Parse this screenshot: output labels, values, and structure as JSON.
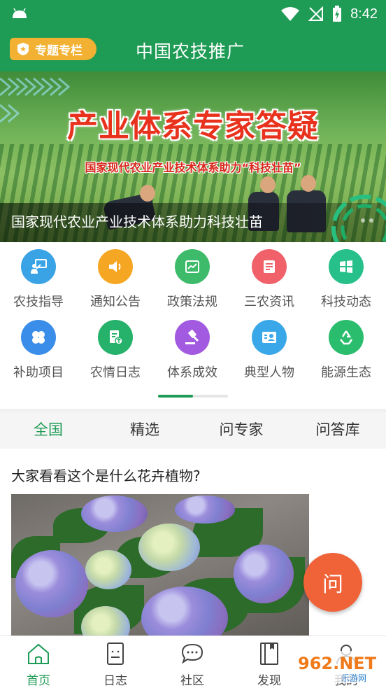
{
  "status_bar": {
    "time": "8:42"
  },
  "app_bar": {
    "special_label": "专题专栏",
    "title": "中国农技推广"
  },
  "banner": {
    "headline": "产业体系专家答疑",
    "subheadline": "国家现代农业产业技术体系助力“科技壮苗”",
    "caption": "国家现代农业产业技术体系助力科技壮苗"
  },
  "grid": [
    {
      "label": "农技指导",
      "icon": "person-board-icon",
      "color": "#3aa3e6"
    },
    {
      "label": "通知公告",
      "icon": "speaker-icon",
      "color": "#f5a623"
    },
    {
      "label": "政策法规",
      "icon": "document-chart-icon",
      "color": "#3dbb6a"
    },
    {
      "label": "三农资讯",
      "icon": "news-list-icon",
      "color": "#f0616a"
    },
    {
      "label": "科技动态",
      "icon": "windows-icon",
      "color": "#27c08a"
    },
    {
      "label": "补助项目",
      "icon": "four-petal-icon",
      "color": "#3a8de8"
    },
    {
      "label": "农情日志",
      "icon": "log-upload-icon",
      "color": "#27b26c"
    },
    {
      "label": "体系成效",
      "icon": "gavel-icon",
      "color": "#a25be0"
    },
    {
      "label": "典型人物",
      "icon": "id-card-icon",
      "color": "#3aa8e8"
    },
    {
      "label": "能源生态",
      "icon": "recycle-icon",
      "color": "#2bbd6e"
    }
  ],
  "tabs": [
    "全国",
    "精选",
    "问专家",
    "问答库"
  ],
  "active_tab": 0,
  "post": {
    "title": "大家看看这个是什么花卉植物?"
  },
  "fab": {
    "label": "问"
  },
  "bottom_nav": [
    {
      "label": "首页",
      "icon": "home-icon"
    },
    {
      "label": "日志",
      "icon": "journal-icon"
    },
    {
      "label": "社区",
      "icon": "chat-icon"
    },
    {
      "label": "发现",
      "icon": "book-icon"
    },
    {
      "label": "我的",
      "icon": "user-icon"
    }
  ],
  "colors": {
    "primary": "#1e9b55",
    "accent": "#f2b133",
    "fab": "#f06238"
  },
  "watermark": {
    "text": "962.NET",
    "subtext": "乐游网"
  }
}
